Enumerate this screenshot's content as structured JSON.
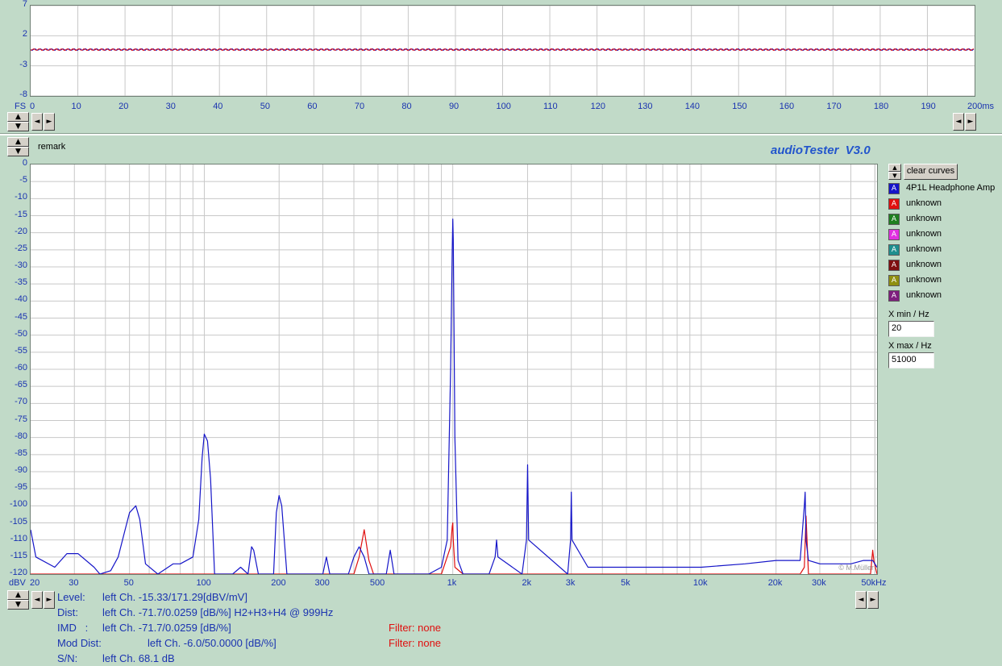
{
  "colors": {
    "background": "#c1dac8",
    "plot_background": "#ffffff",
    "grid": "#c8c8c8",
    "axis_text": "#1a33b0",
    "trace_blue": "#1515c8",
    "trace_red": "#e01010",
    "title_accent": "#2255cc"
  },
  "top_chart": {
    "y_ticks": [
      "7",
      "2",
      "-3",
      "-8"
    ],
    "x_unit_left": "FS",
    "x_ticks": [
      "0",
      "10",
      "20",
      "30",
      "40",
      "50",
      "60",
      "70",
      "80",
      "90",
      "100",
      "110",
      "120",
      "130",
      "140",
      "150",
      "160",
      "170",
      "180",
      "190",
      "200ms"
    ]
  },
  "header": {
    "remark": "remark",
    "app_title": "audioTester  V3.0"
  },
  "chart_data": [
    {
      "type": "line",
      "title": "",
      "xlabel": "ms",
      "ylabel": "FS",
      "xlim": [
        0,
        200
      ],
      "ylim": [
        -8,
        7
      ],
      "grid": true,
      "series": [
        {
          "color": "#1515c8",
          "x": [
            0,
            200
          ],
          "y": [
            -0.3,
            -0.3
          ]
        },
        {
          "color": "#e01010",
          "x": [
            0,
            200
          ],
          "y": [
            -0.3,
            -0.3
          ]
        }
      ]
    },
    {
      "type": "line",
      "title": "",
      "xlabel": "",
      "ylabel": "dBV",
      "xscale": "log",
      "xlim": [
        20,
        51000
      ],
      "ylim": [
        -120,
        0
      ],
      "grid": true,
      "series": [
        {
          "name": "4P1L Headphone Amp",
          "color": "#1515c8",
          "x": [
            20,
            21,
            25,
            28,
            30,
            31,
            36,
            38,
            42,
            45,
            48,
            50,
            53,
            55,
            58,
            65,
            75,
            80,
            90,
            95,
            98,
            100,
            103,
            106,
            110,
            115,
            130,
            140,
            150,
            155,
            158,
            165,
            190,
            195,
            200,
            205,
            215,
            250,
            300,
            310,
            320,
            380,
            400,
            420,
            440,
            460,
            480,
            540,
            560,
            580,
            800,
            900,
            950,
            980,
            995,
            1000,
            1005,
            1020,
            1050,
            1100,
            1400,
            1480,
            1500,
            1520,
            1900,
            1980,
            2000,
            2020,
            2900,
            2980,
            3000,
            3020,
            3500,
            4000,
            5000,
            8000,
            10000,
            15000,
            20000,
            25000,
            26000,
            26200,
            26400,
            27000,
            30000,
            40000,
            45000,
            49000,
            51000
          ],
          "y": [
            -107,
            -115,
            -118,
            -114,
            -114,
            -114,
            -118,
            -120,
            -119,
            -115,
            -107,
            -102,
            -100,
            -104,
            -117,
            -120,
            -117,
            -117,
            -115,
            -104,
            -86,
            -79,
            -81,
            -92,
            -120,
            -120,
            -120,
            -118,
            -120,
            -112,
            -113,
            -120,
            -120,
            -102,
            -97,
            -100,
            -120,
            -120,
            -120,
            -115,
            -120,
            -120,
            -115,
            -112,
            -115,
            -120,
            -120,
            -120,
            -113,
            -120,
            -120,
            -118,
            -110,
            -60,
            -25,
            -16,
            -22,
            -80,
            -116,
            -120,
            -120,
            -115,
            -110,
            -115,
            -120,
            -110,
            -88,
            -110,
            -120,
            -110,
            -96,
            -110,
            -118,
            -118,
            -118,
            -118,
            -118,
            -117,
            -116,
            -116,
            -100,
            -96,
            -110,
            -116,
            -117,
            -117,
            -116,
            -116,
            -118
          ]
        },
        {
          "name": "unknown",
          "color": "#e01010",
          "x": [
            20,
            400,
            420,
            440,
            460,
            480,
            900,
            980,
            995,
            1000,
            1005,
            1020,
            1100,
            25000,
            26000,
            26400,
            27000,
            48000,
            49000,
            49500,
            51000
          ],
          "y": [
            -120,
            -120,
            -115,
            -107,
            -116,
            -120,
            -120,
            -112,
            -106,
            -105,
            -110,
            -118,
            -120,
            -120,
            -118,
            -103,
            -120,
            -120,
            -113,
            -116,
            -120
          ]
        }
      ]
    }
  ],
  "spectrum_axes": {
    "y_ticks": [
      "0",
      "-5",
      "-10",
      "-15",
      "-20",
      "-25",
      "-30",
      "-35",
      "-40",
      "-45",
      "-50",
      "-55",
      "-60",
      "-65",
      "-70",
      "-75",
      "-80",
      "-85",
      "-90",
      "-95",
      "-100",
      "-105",
      "-110",
      "-115",
      "-120"
    ],
    "x_unit_left": "dBV",
    "x_ticks": [
      "20",
      "30",
      "50",
      "100",
      "200",
      "300",
      "500",
      "1k",
      "2k",
      "3k",
      "5k",
      "10k",
      "20k",
      "30k",
      "50kHz"
    ],
    "watermark": "© M.Müller"
  },
  "legend": {
    "clear_label": "clear curves",
    "items": [
      {
        "label": "4P1L Headphone Amp",
        "color": "#1515c8",
        "glyph": "A"
      },
      {
        "label": "unknown",
        "color": "#e01010",
        "glyph": "A"
      },
      {
        "label": "unknown",
        "color": "#1f7f1f",
        "glyph": "A"
      },
      {
        "label": "unknown",
        "color": "#e030e0",
        "glyph": "A"
      },
      {
        "label": "unknown",
        "color": "#1f8f8f",
        "glyph": "A"
      },
      {
        "label": "unknown",
        "color": "#7f1010",
        "glyph": "A"
      },
      {
        "label": "unknown",
        "color": "#8f8f10",
        "glyph": "A"
      },
      {
        "label": "unknown",
        "color": "#7f1f7f",
        "glyph": "A"
      }
    ],
    "xmin_label": "X min / Hz",
    "xmin_value": "20",
    "xmax_label": "X max / Hz",
    "xmax_value": "51000"
  },
  "stats": {
    "level_label": "Level:",
    "level_value": "left Ch. -15.33/171.29[dBV/mV]",
    "dist_label": "Dist:",
    "dist_value": "left Ch. -71.7/0.0259 [dB/%] H2+H3+H4 @ 999Hz",
    "imd_label": "IMD   :",
    "imd_value": "left Ch. -71.7/0.0259 [dB/%]",
    "imd_filter": "Filter: none",
    "moddist_label": "Mod Dist:",
    "moddist_value": "left Ch. -6.0/50.0000 [dB/%]",
    "moddist_filter": "Filter: none",
    "sn_label": "S/N:",
    "sn_value": "left Ch. 68.1 dB"
  },
  "controls": {
    "up": "▲",
    "down": "▼",
    "left": "◄",
    "right": "►"
  }
}
